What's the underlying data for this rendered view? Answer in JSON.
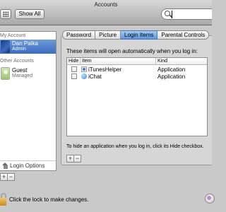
{
  "window": {
    "title": "Accounts"
  },
  "toolbar": {
    "show_all_label": "Show All",
    "search_value": "",
    "search_placeholder": ""
  },
  "sidebar": {
    "my_account_header": "My Account",
    "other_accounts_header": "Other Accounts",
    "accounts": [
      {
        "name": "Dan Palka",
        "role": "Admin",
        "selected": true,
        "avatar": "blue-swirl-avatar"
      },
      {
        "name": "Guest",
        "role": "Managed",
        "selected": false,
        "avatar": "guest-avatar"
      }
    ],
    "login_options_label": "Login Options",
    "add_label": "+",
    "remove_label": "−"
  },
  "tabs": [
    {
      "label": "Password",
      "active": false
    },
    {
      "label": "Picture",
      "active": false
    },
    {
      "label": "Login Items",
      "active": true
    },
    {
      "label": "Parental Controls",
      "active": false
    }
  ],
  "main": {
    "instruction": "These items will open automatically when you log in:",
    "table": {
      "headers": {
        "hide": "Hide",
        "item": "Item",
        "kind": "Kind"
      },
      "rows": [
        {
          "hide": false,
          "item": "iTunesHelper",
          "kind": "Application",
          "icon": "itunes-icon"
        },
        {
          "hide": false,
          "item": "iChat",
          "kind": "Application",
          "icon": "ichat-icon"
        }
      ]
    },
    "hint": "To hide an application when you log in, click its Hide checkbox.",
    "add_label": "+",
    "remove_label": "−"
  },
  "footer": {
    "lock_message": "Click the lock to make changes."
  },
  "colors": {
    "selection": "#3c6cc0",
    "active_tab": "#5796de",
    "window_bg": "#c9c9c9"
  }
}
